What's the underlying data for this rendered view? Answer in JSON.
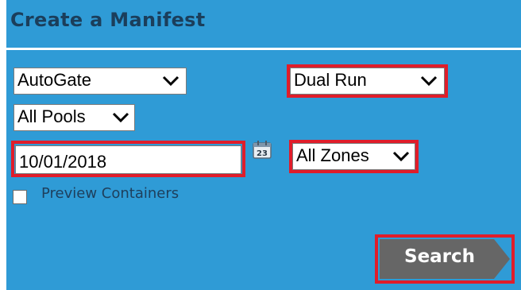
{
  "panel": {
    "title": "Create a Manifest"
  },
  "form": {
    "gate_select": {
      "value": "AutoGate"
    },
    "run_select": {
      "value": "Dual Run"
    },
    "pool_select": {
      "value": "All Pools"
    },
    "date_input": {
      "value": "10/01/2018"
    },
    "calendar_day": "23",
    "zone_select": {
      "value": "All Zones"
    },
    "preview_checkbox": {
      "label": "Preview Containers",
      "checked": false
    },
    "search_button": {
      "label": "Search"
    }
  },
  "colors": {
    "panel_bg": "#2f9bd6",
    "title": "#1b3e5b",
    "highlight": "#e01d2a",
    "button": "#666666"
  }
}
